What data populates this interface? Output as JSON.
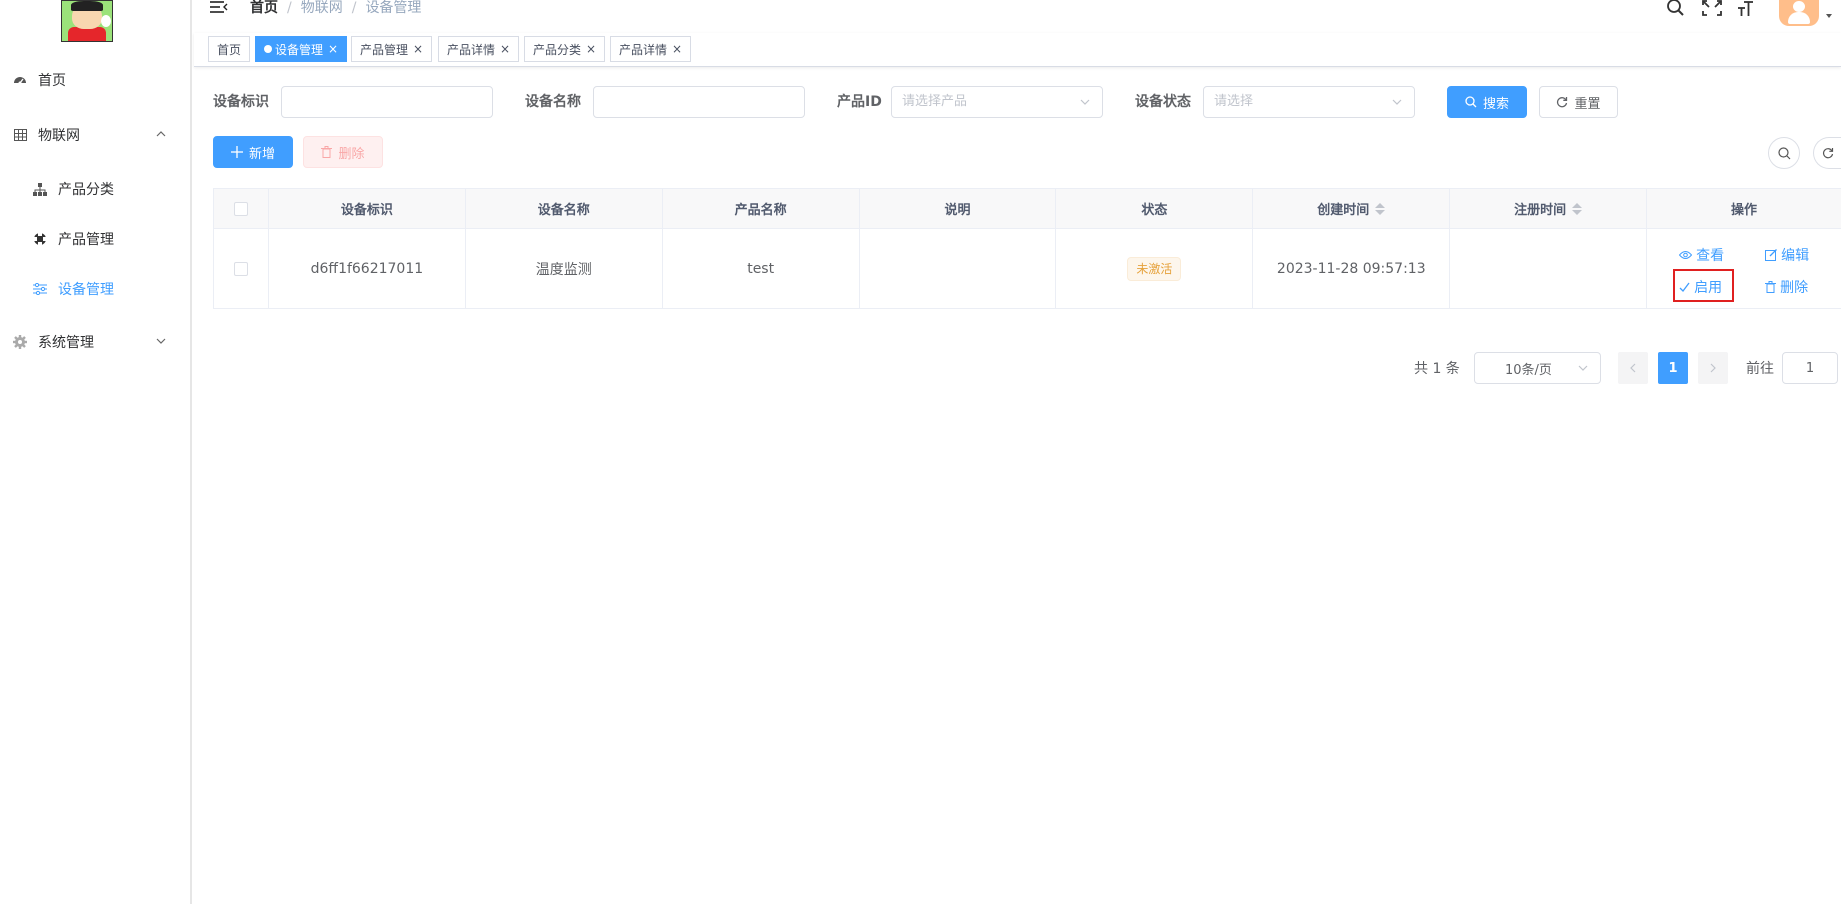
{
  "sidebar": {
    "items": [
      {
        "label": "首页",
        "icon": "dashboard-icon"
      },
      {
        "label": "物联网",
        "icon": "grid-icon",
        "expanded": true
      },
      {
        "label": "产品分类",
        "icon": "tree-icon"
      },
      {
        "label": "产品管理",
        "icon": "product-icon"
      },
      {
        "label": "设备管理",
        "icon": "sliders-icon",
        "active": true
      },
      {
        "label": "系统管理",
        "icon": "gear-icon",
        "expanded": false
      }
    ]
  },
  "breadcrumb": {
    "home": "首页",
    "level1": "物联网",
    "level2": "设备管理"
  },
  "tags": [
    {
      "label": "首页"
    },
    {
      "label": "设备管理",
      "active": true
    },
    {
      "label": "产品管理"
    },
    {
      "label": "产品详情"
    },
    {
      "label": "产品分类"
    },
    {
      "label": "产品详情"
    }
  ],
  "search": {
    "device_id_label": "设备标识",
    "device_id_value": "",
    "device_name_label": "设备名称",
    "device_name_value": "",
    "product_id_label": "产品ID",
    "product_id_placeholder": "请选择产品",
    "status_label": "设备状态",
    "status_placeholder": "请选择",
    "search_button": "搜索",
    "reset_button": "重置"
  },
  "toolbar": {
    "add_button": "新增",
    "delete_button": "删除"
  },
  "table": {
    "columns": [
      "设备标识",
      "设备名称",
      "产品名称",
      "说明",
      "状态",
      "创建时间",
      "注册时间",
      "操作"
    ],
    "rows": [
      {
        "device_id": "d6ff1f66217011",
        "device_name": "温度监测",
        "product_name": "test",
        "description": "",
        "status": "未激活",
        "created_at": "2023-11-28 09:57:13",
        "registered_at": "",
        "actions": {
          "view": "查看",
          "edit": "编辑",
          "enable": "启用",
          "delete": "删除"
        }
      }
    ]
  },
  "pagination": {
    "total_text": "共 1 条",
    "page_size": "10条/页",
    "current_page": "1",
    "goto_label": "前往",
    "goto_value": "1"
  },
  "colors": {
    "primary": "#409eff",
    "warning": "#e6a23c",
    "highlight": "#e02020"
  }
}
